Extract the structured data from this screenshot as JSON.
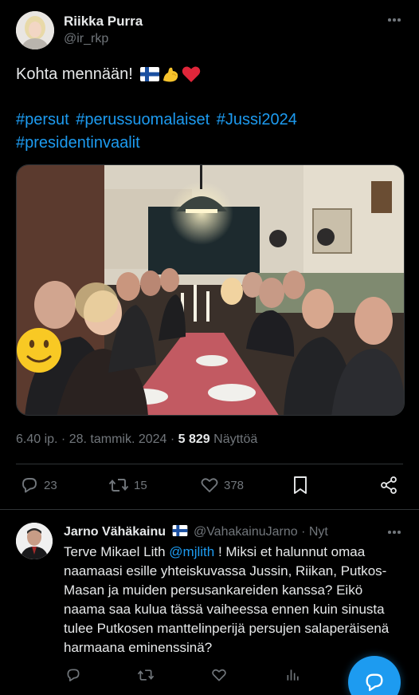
{
  "tweet": {
    "author_name": "Riikka Purra",
    "author_handle": "@ir_rkp",
    "text": "Kohta mennään!",
    "hashtags": [
      "#persut",
      "#perussuomalaiset",
      "#Jussi2024",
      "#presidentinvaalit"
    ],
    "timestamp": "6.40 ip. · 28. tammik. 2024 ·",
    "views_count": "5 829",
    "views_label": "Näyttöä",
    "replies_count": "23",
    "retweets_count": "15",
    "likes_count": "378"
  },
  "reply": {
    "author_name": "Jarno Vähäkainu",
    "author_handle": "@VahakainuJarno · Nyt",
    "text_before": "Terve Mikael Lith ",
    "mention": "@mjlith",
    "text_after": " ! Miksi et halunnut omaa naamaasi esille yhteiskuvassa Jussin, Riikan, Putkos-Masan ja muiden persusankareiden kanssa? Eikö naama saa kulua tässä vaiheessa ennen kuin sinusta tulee Putkosen manttelinperijä persujen salaperäisenä harmaana eminenssinä?"
  },
  "colors": {
    "background": "#000000",
    "text": "#e7e9ea",
    "muted": "#71767b",
    "accent": "#1d9bf0",
    "divider": "#2f3336"
  },
  "icons": {
    "reply": "comment-icon",
    "retweet": "retweet-icon",
    "like": "heart-icon",
    "bookmark": "bookmark-icon",
    "share": "share-icon",
    "analytics": "analytics-icon",
    "compose": "compose-reply-icon"
  }
}
